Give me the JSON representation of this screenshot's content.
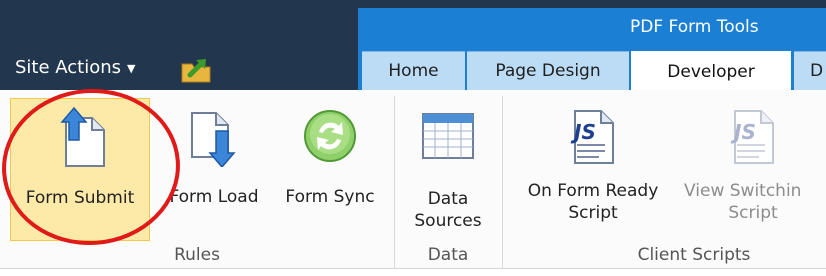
{
  "header": {
    "context_title": "PDF Form Tools",
    "site_actions_label": "Site Actions",
    "tabs": [
      {
        "label": "Home",
        "state": "inactive"
      },
      {
        "label": "Page Design",
        "state": "inactive"
      },
      {
        "label": "Developer",
        "state": "active"
      },
      {
        "label": "D",
        "state": "inactive"
      }
    ]
  },
  "ribbon": {
    "groups": [
      {
        "label": "Rules",
        "buttons": [
          {
            "label": "Form Submit",
            "icon": "form-submit-icon",
            "state": "selected"
          },
          {
            "label": "Form Load",
            "icon": "form-load-icon"
          },
          {
            "label": "Form Sync",
            "icon": "form-sync-icon"
          }
        ]
      },
      {
        "label": "Data",
        "buttons": [
          {
            "label_line1": "Data",
            "label_line2": "Sources",
            "icon": "data-sources-icon"
          }
        ]
      },
      {
        "label": "Client Scripts",
        "buttons": [
          {
            "label_line1": "On Form Ready",
            "label_line2": "Script",
            "icon": "js-script-icon"
          },
          {
            "label_line1": "View Switchin",
            "label_line2": "Script",
            "icon": "js-script-disabled-icon",
            "state": "disabled"
          }
        ]
      }
    ]
  },
  "colors": {
    "top_bar": "#22374e",
    "context_band": "#1b7fd3",
    "tab_inactive": "#bcdcf5",
    "selected_button": "#fde9a8",
    "annotation_circle": "#e01919"
  }
}
